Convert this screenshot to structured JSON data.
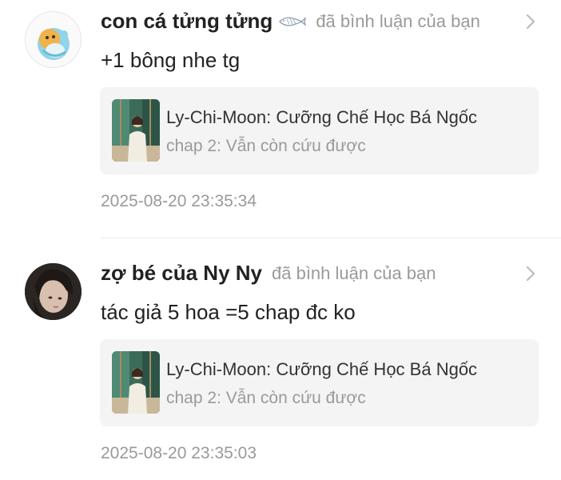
{
  "notifications": [
    {
      "avatar_icon": "cartoon-dinosaur-avatar",
      "username": "con cá tửng tửng",
      "badge_icon": "fish-badge-icon",
      "action": "đã bình luận của bạn",
      "comment": "+1 bông nhe tg",
      "story": {
        "title": "Ly-Chi-Moon: Cưỡng Chế Học Bá Ngốc",
        "chapter": "chap 2: Vẫn còn cứu được"
      },
      "timestamp": "2025-08-20 23:35:34"
    },
    {
      "avatar_icon": "user-photo-avatar",
      "username": "zợ bé của Ny Ny",
      "action": "đã bình luận của bạn",
      "comment": "tác giả 5 hoa =5 chap đc ko",
      "story": {
        "title": "Ly-Chi-Moon: Cưỡng Chế Học Bá Ngốc",
        "chapter": "chap 2: Vẫn còn cứu được"
      },
      "timestamp": "2025-08-20 23:35:03"
    }
  ],
  "colors": {
    "text_primary": "#222222",
    "text_secondary": "#9a9a9a",
    "card_background": "#f4f4f4",
    "divider": "#e8e8e8"
  }
}
